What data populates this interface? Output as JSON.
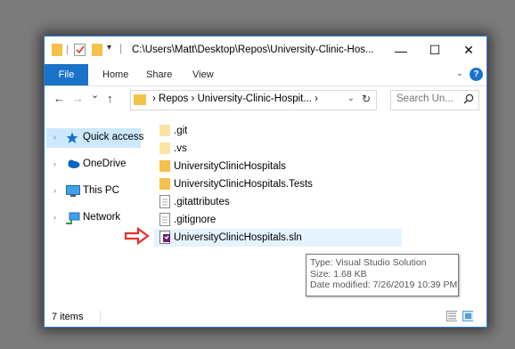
{
  "window": {
    "title_path": "C:\\Users\\Matt\\Desktop\\Repos\\University-Clinic-Hos...",
    "minimize_symbol": "—",
    "maximize_symbol": "☐",
    "close_symbol": "✕"
  },
  "ribbon": {
    "tabs": [
      {
        "label": "File"
      },
      {
        "label": "Home"
      },
      {
        "label": "Share"
      },
      {
        "label": "View"
      }
    ],
    "help_label": "?"
  },
  "address": {
    "back_symbol": "←",
    "forward_symbol": "→",
    "recent_symbol": "⌄",
    "up_symbol": "↑",
    "path": "›  Repos  ›  University-Clinic-Hospit...  ›",
    "dropdown_symbol": "⌄",
    "refresh_symbol": "↻"
  },
  "search": {
    "placeholder": "Search Un..."
  },
  "nav_pane": {
    "items": [
      {
        "label": "Quick access",
        "icon": "star-icon",
        "selected": true
      },
      {
        "label": "OneDrive",
        "icon": "cloud-icon",
        "selected": false
      },
      {
        "label": "This PC",
        "icon": "monitor-icon",
        "selected": false
      },
      {
        "label": "Network",
        "icon": "network-icon",
        "selected": false
      }
    ]
  },
  "files": [
    {
      "name": ".git",
      "icon": "folder-light-icon"
    },
    {
      "name": ".vs",
      "icon": "folder-light-icon"
    },
    {
      "name": "UniversityClinicHospitals",
      "icon": "folder-icon"
    },
    {
      "name": "UniversityClinicHospitals.Tests",
      "icon": "folder-icon"
    },
    {
      "name": ".gitattributes",
      "icon": "document-icon"
    },
    {
      "name": ".gitignore",
      "icon": "document-icon"
    },
    {
      "name": "UniversityClinicHospitals.sln",
      "icon": "visual-studio-solution-icon"
    }
  ],
  "tooltip": {
    "type": "Type: Visual Studio Solution",
    "size": "Size: 1.68 KB",
    "date": "Date modified: 7/26/2019 10:39 PM"
  },
  "status": {
    "item_count": "7 items"
  },
  "colors": {
    "accent": "#1a73c9",
    "selection": "#cce8ff",
    "hover": "#e5f3ff",
    "folder": "#f4c14a",
    "arrow": "#e8302a"
  }
}
